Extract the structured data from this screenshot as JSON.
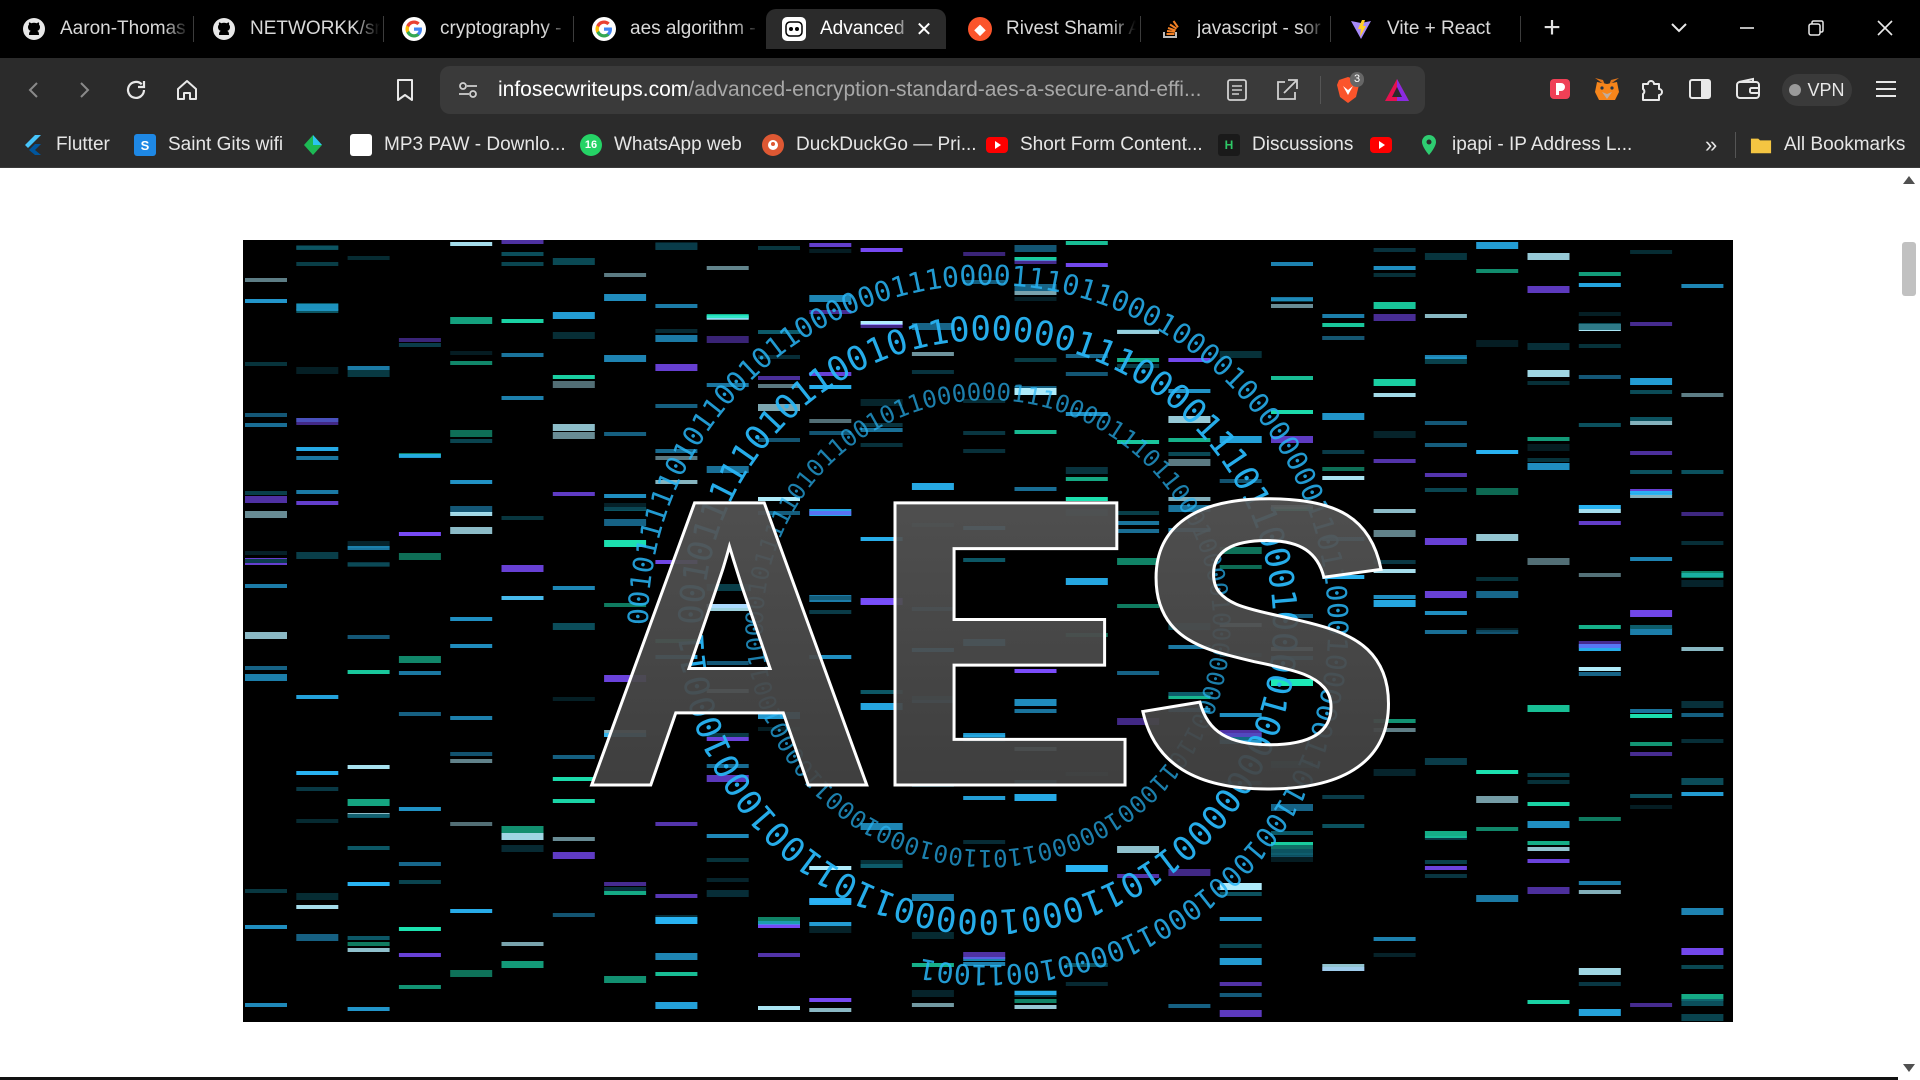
{
  "tabs": [
    {
      "title": "Aaron-Thomas",
      "icon": "github-icon"
    },
    {
      "title": "NETWORKK/src",
      "icon": "github-icon"
    },
    {
      "title": "cryptography -",
      "icon": "google-icon"
    },
    {
      "title": "aes algorithm -",
      "icon": "google-icon"
    },
    {
      "title": "Advanced",
      "icon": "infosec-icon",
      "active": true
    },
    {
      "title": "Rivest Shamir A",
      "icon": "brave-icon"
    },
    {
      "title": "javascript - sor",
      "icon": "stackoverflow-icon"
    },
    {
      "title": "Vite + React",
      "icon": "vite-icon"
    }
  ],
  "address_bar": {
    "host": "infosecwriteups.com",
    "path": "/advanced-encryption-standard-aes-a-secure-and-effi...",
    "shields_count": "3"
  },
  "vpn_label": "VPN",
  "bookmarks": [
    {
      "label": "Flutter",
      "icon": "flutter-icon"
    },
    {
      "label": "Saint Gits wifi",
      "icon": "saintgits-icon"
    },
    {
      "label": "",
      "icon": "diamond-icon"
    },
    {
      "label": "MP3 PAW - Downlo...",
      "icon": "mp3paw-icon"
    },
    {
      "label": "WhatsApp web",
      "icon": "whatsapp-icon"
    },
    {
      "label": "DuckDuckGo — Pri...",
      "icon": "duckduckgo-icon"
    },
    {
      "label": "Short Form Content...",
      "icon": "youtube-icon"
    },
    {
      "label": "Discussions",
      "icon": "hackerrank-icon"
    },
    {
      "label": "",
      "icon": "youtube-icon"
    },
    {
      "label": "ipapi - IP Address L...",
      "icon": "map-pin-icon"
    }
  ],
  "bookmarks_overflow": "»",
  "all_bookmarks_label": "All Bookmarks",
  "hero_image": {
    "headline": "AES",
    "binary_ring": "001011111010110010110000001110000111011000100001000000001101100010000011011001000100011000010011001",
    "colors": {
      "background": "#000000",
      "cyan": "#29b6f6",
      "teal": "#1de9b6",
      "violet": "#7c4dff",
      "letter_fill": "#4a4a4a"
    }
  }
}
